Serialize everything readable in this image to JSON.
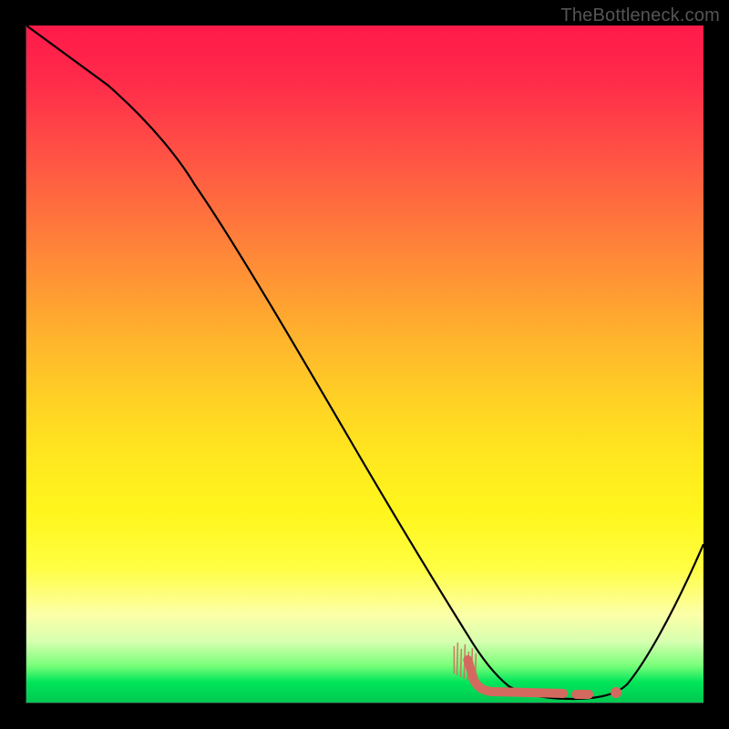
{
  "watermark": "TheBottleneck.com",
  "chart_data": {
    "type": "line",
    "title": "",
    "xlabel": "",
    "ylabel": "",
    "xlim": [
      0,
      100
    ],
    "ylim": [
      0,
      100
    ],
    "grid": false,
    "series": [
      {
        "name": "curve",
        "x": [
          0,
          10,
          20,
          23,
          30,
          40,
          50,
          60,
          65,
          70,
          75,
          80,
          85,
          90,
          95,
          100
        ],
        "y": [
          100,
          90,
          80,
          77,
          66,
          51,
          36,
          21,
          14,
          7,
          3,
          1,
          0.5,
          3,
          12,
          25
        ]
      }
    ],
    "annotations": {
      "coral_segment": {
        "x_start": 63,
        "x_end": 83,
        "y_approx": 4
      },
      "coral_dot": {
        "x": 87,
        "y": 2.5
      }
    },
    "legend": []
  }
}
